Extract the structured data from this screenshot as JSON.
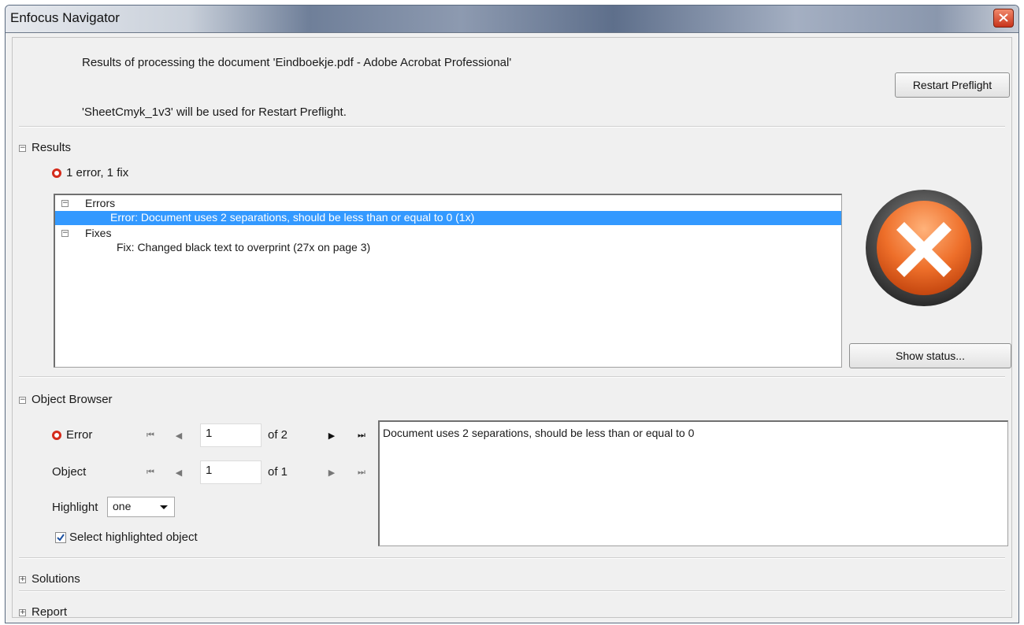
{
  "window": {
    "title": "Enfocus Navigator"
  },
  "header": {
    "line1": "Results of processing the document 'Eindboekje.pdf - Adobe Acrobat Professional'",
    "line2": "'SheetCmyk_1v3' will be used for Restart Preflight.",
    "restart_label": "Restart Preflight"
  },
  "results": {
    "section_label": "Results",
    "summary": "1 error, 1 fix",
    "tree": {
      "errors_label": "Errors",
      "error_item": "Error: Document uses 2 separations, should be less than or equal to 0 (1x)",
      "fixes_label": "Fixes",
      "fix_item": "Fix: Changed black text to overprint (27x on page 3)"
    },
    "show_status_label": "Show status..."
  },
  "object_browser": {
    "section_label": "Object Browser",
    "error_row": {
      "label": "Error",
      "value": "1",
      "of_label": "of 2"
    },
    "object_row": {
      "label": "Object",
      "value": "1",
      "of_label": "of 1"
    },
    "highlight": {
      "label": "Highlight",
      "value": "one"
    },
    "select_highlighted": {
      "label": "Select highlighted object",
      "checked": true
    },
    "description": "Document uses 2 separations, should be less than or equal to 0"
  },
  "solutions": {
    "section_label": "Solutions"
  },
  "report": {
    "section_label": "Report"
  },
  "colors": {
    "error_red": "#d42b1b",
    "selection_blue": "#3399ff",
    "status_orange": "#e8692c"
  }
}
